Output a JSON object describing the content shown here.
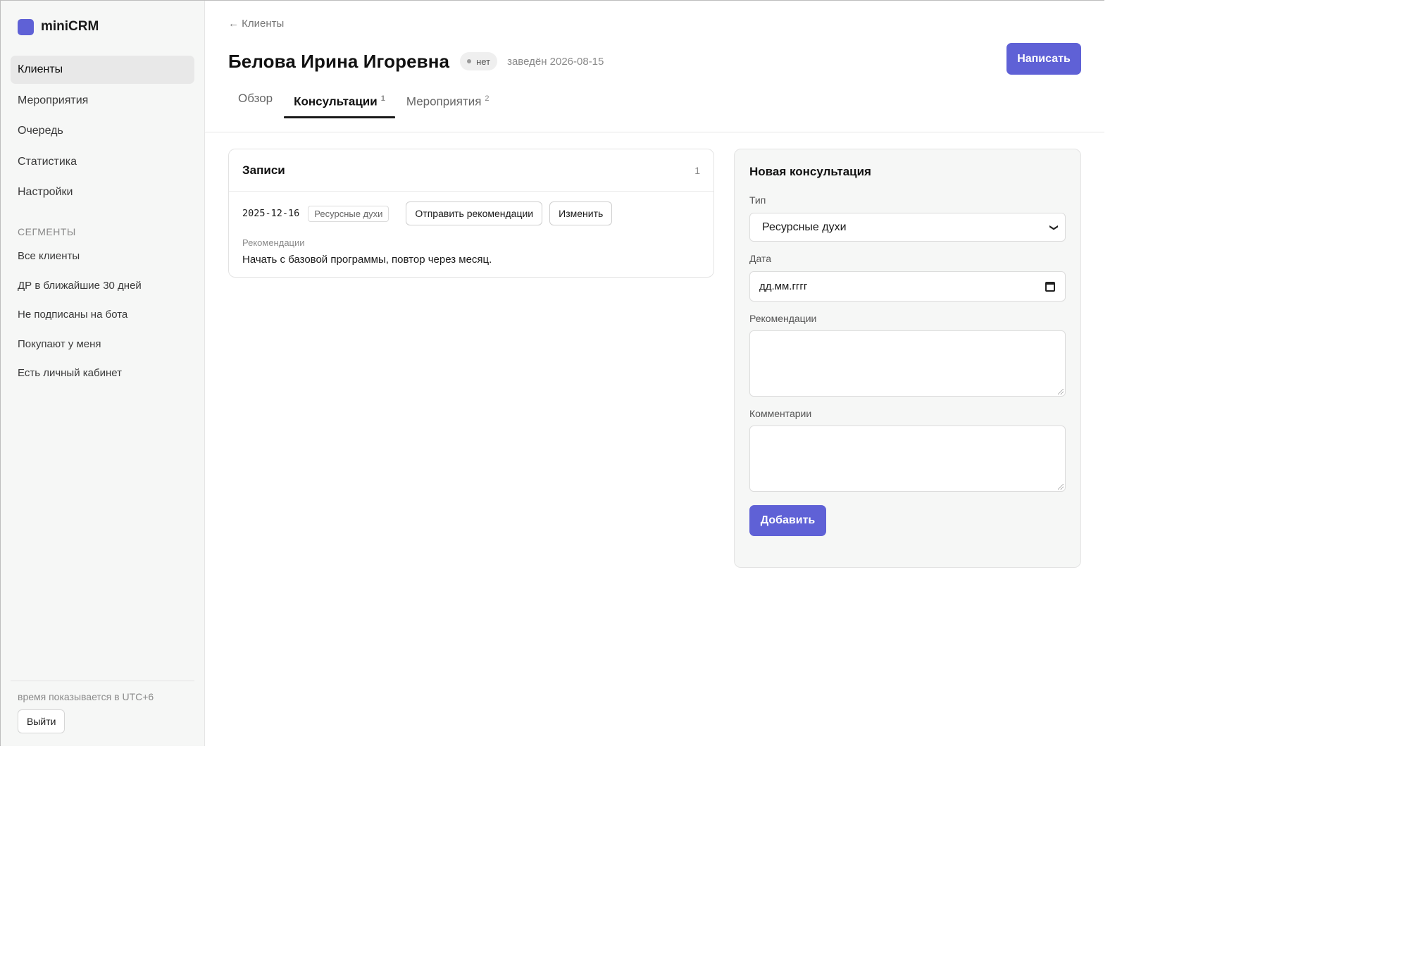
{
  "brand": {
    "name": "miniCRM",
    "accent": "#5f61d6"
  },
  "sidebar": {
    "nav": [
      {
        "label": "Клиенты",
        "active": true
      },
      {
        "label": "Мероприятия",
        "active": false
      },
      {
        "label": "Очередь",
        "active": false
      },
      {
        "label": "Статистика",
        "active": false
      },
      {
        "label": "Настройки",
        "active": false
      }
    ],
    "segments_title": "СЕГМЕНТЫ",
    "segments": [
      {
        "label": "Все клиенты"
      },
      {
        "label": "ДР в ближайшие 30 дней"
      },
      {
        "label": "Не подписаны на бота"
      },
      {
        "label": "Покупают у меня"
      },
      {
        "label": "Есть личный кабинет"
      }
    ],
    "timezone_note": "время показывается в UTC+6",
    "logout_label": "Выйти"
  },
  "header": {
    "breadcrumb": "← Клиенты",
    "title": "Белова Ирина Игоревна",
    "status_badge": "нет",
    "created": "заведён 2026-08-15",
    "write_button": "Написать"
  },
  "tabs": [
    {
      "label": "Обзор",
      "count": "",
      "active": false
    },
    {
      "label": "Консультации",
      "count": "1",
      "active": true
    },
    {
      "label": "Мероприятия",
      "count": "2",
      "active": false
    }
  ],
  "records": {
    "title": "Записи",
    "count": "1",
    "items": [
      {
        "date": "2025-12-16",
        "type": "Ресурсные духи",
        "send_button": "Отправить рекомендации",
        "edit_button": "Изменить",
        "recommendations_label": "Рекомендации",
        "recommendations": "Начать с базовой программы, повтор через месяц."
      }
    ]
  },
  "new_consultation": {
    "title": "Новая консультация",
    "type_label": "Тип",
    "type_value": "Ресурсные духи",
    "date_label": "Дата",
    "date_placeholder": "дд.мм.гггг",
    "recommendations_label": "Рекомендации",
    "comments_label": "Комментарии",
    "submit_label": "Добавить"
  }
}
